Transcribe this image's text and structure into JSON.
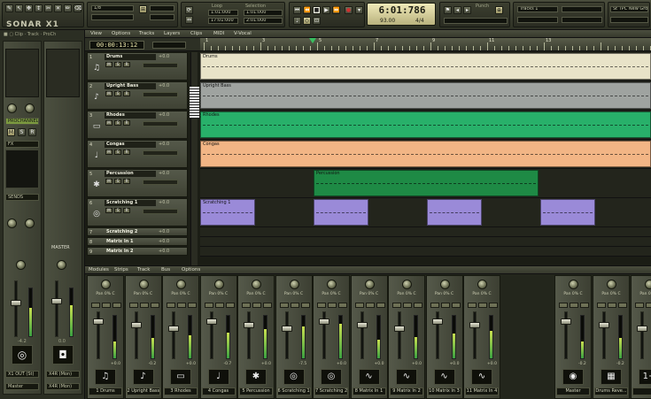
{
  "app": {
    "name": "SONAR X1"
  },
  "control_bar": {
    "time": "6:01:786",
    "tempo": "93.00",
    "meter": "4/4",
    "fields": {
      "snap": "1/8",
      "loop_start": "1:01:000",
      "loop_end": "17:01:000",
      "sel_start": "1:01:000",
      "sel_end": "2:01:000",
      "track_field": "Tracks 1",
      "screenset": "St TPC New Group"
    },
    "labels": {
      "loop": "Loop",
      "selection": "Selection",
      "punch": "Punch",
      "markers": "Markers"
    }
  },
  "inspector": {
    "strip_left_buttons": [
      "FX",
      "SENDS"
    ],
    "output_left": "X1 OUT (St)",
    "output_right": "X4R (Mon)",
    "name_left": "Master",
    "name_right": "X4R (Mon)",
    "master_label": "MASTER",
    "value_left": "-4.2",
    "value_right": "0.0",
    "prochannel": "PROCHANNEL"
  },
  "track_view": {
    "menu": [
      "View",
      "Options",
      "Tracks",
      "Layers",
      "Clips",
      "MIDI",
      "V-Vocal"
    ],
    "now_time": "00:00:13:12",
    "tracks": [
      {
        "num": "1",
        "name": "Drums",
        "info": "+0.0",
        "icon": "♫",
        "color": "#e8e3c8",
        "clip_label": "Drums"
      },
      {
        "num": "2",
        "name": "Upright Bass",
        "info": "+0.0",
        "icon": "♪",
        "color": "#9fa3a0",
        "clip_label": "Upright Bass"
      },
      {
        "num": "3",
        "name": "Rhodes",
        "info": "+0.0",
        "icon": "▭",
        "color": "#28b06a",
        "clip_label": "Rhodes"
      },
      {
        "num": "4",
        "name": "Congas",
        "info": "+0.0",
        "icon": "♩",
        "color": "#f2b585",
        "clip_label": "Congas"
      },
      {
        "num": "5",
        "name": "Percussion",
        "info": "+0.0",
        "icon": "✱",
        "color": "#1e8a45",
        "clip_label": "Percussion"
      },
      {
        "num": "6",
        "name": "Scratching 1",
        "info": "+0.0",
        "icon": "◎",
        "color": "#9a8ad8",
        "clip_label": "Scratching 1"
      },
      {
        "num": "7",
        "name": "Scratching 2",
        "info": "+0.0"
      },
      {
        "num": "8",
        "name": "Matrix In 1",
        "info": "+0.0"
      },
      {
        "num": "9",
        "name": "Matrix In 2",
        "info": "+0.0"
      }
    ],
    "ruler": [
      "1",
      "3",
      "5",
      "7",
      "9",
      "11",
      "13"
    ]
  },
  "console": {
    "menu": [
      "Modules",
      "Strips",
      "Track",
      "Bus",
      "Options"
    ],
    "pan_label": "Pan 0% C",
    "strips": [
      {
        "name": "Drums",
        "num": "1",
        "icon": "♫",
        "value": "+0.0"
      },
      {
        "name": "Upright Bass",
        "num": "2",
        "icon": "♪",
        "value": "-0.2"
      },
      {
        "name": "Rhodes",
        "num": "3",
        "icon": "▭",
        "value": "+0.0"
      },
      {
        "name": "Congas",
        "num": "4",
        "icon": "♩",
        "value": "-0.7"
      },
      {
        "name": "Percussion",
        "num": "5",
        "icon": "✱",
        "value": "+0.0"
      },
      {
        "name": "Scratching 1",
        "num": "6",
        "icon": "◎",
        "value": "-7.5"
      },
      {
        "name": "Scratching 2",
        "num": "7",
        "icon": "◎",
        "value": "+0.0"
      },
      {
        "name": "Matrix In 1",
        "num": "8",
        "icon": "∿",
        "value": "+0.0"
      },
      {
        "name": "Matrix In 2",
        "num": "9",
        "icon": "∿",
        "value": "+0.0"
      },
      {
        "name": "Matrix In 3",
        "num": "10",
        "icon": "∿",
        "value": "+0.0"
      },
      {
        "name": "Matrix In 4",
        "num": "11",
        "icon": "∿",
        "value": "+0.0"
      }
    ],
    "bus_strips": [
      {
        "name": "Master",
        "icon": "◉",
        "value": "-0.2"
      },
      {
        "name": "Drums Reve...",
        "icon": "▦",
        "value": "-0.2"
      },
      {
        "name": "",
        "icon": "1+",
        "value": ""
      }
    ]
  }
}
